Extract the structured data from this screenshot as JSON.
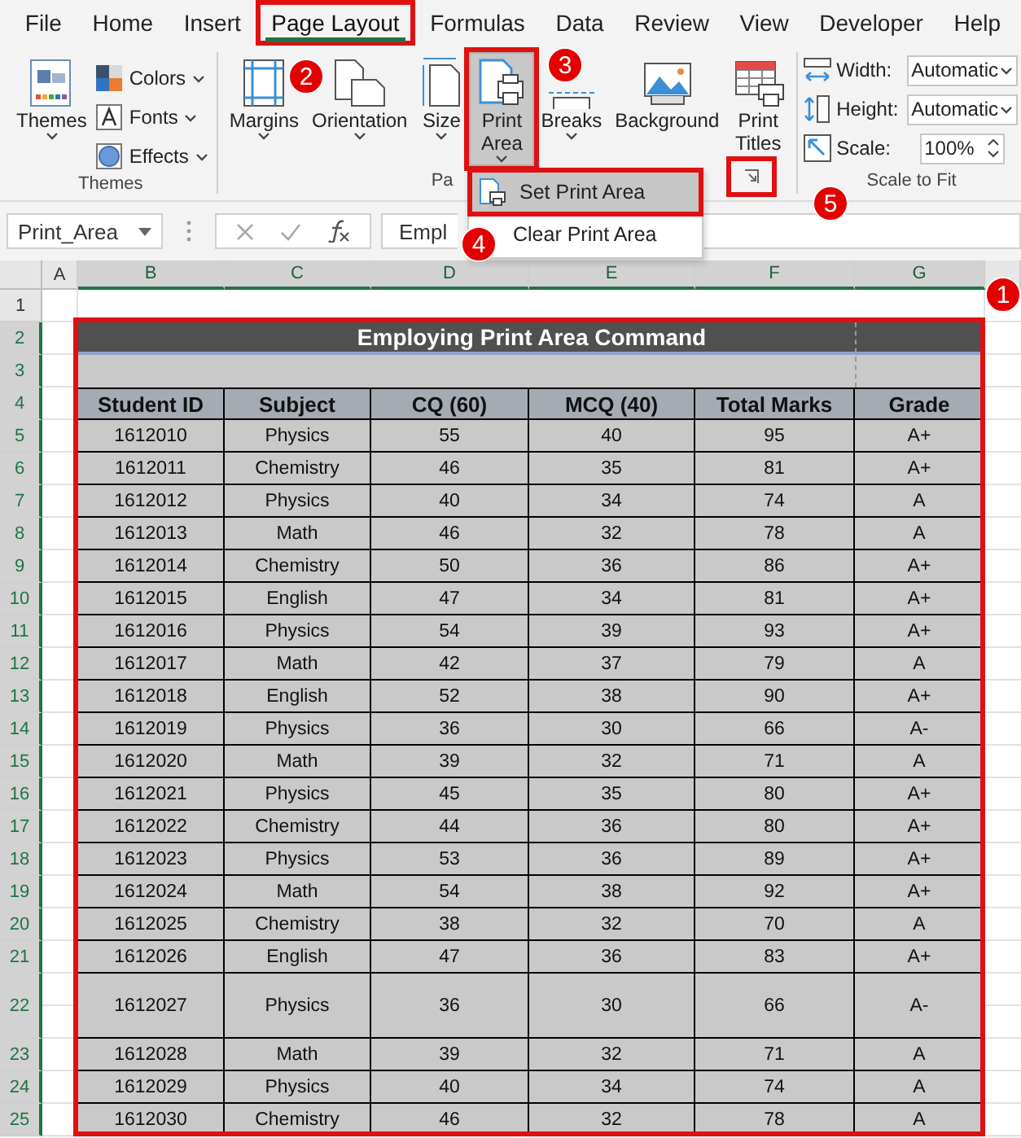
{
  "tabs": [
    {
      "label": "File",
      "selected": false,
      "highlighted": false
    },
    {
      "label": "Home",
      "selected": false,
      "highlighted": false
    },
    {
      "label": "Insert",
      "selected": false,
      "highlighted": false
    },
    {
      "label": "Page Layout",
      "selected": true,
      "highlighted": true
    },
    {
      "label": "Formulas",
      "selected": false,
      "highlighted": false
    },
    {
      "label": "Data",
      "selected": false,
      "highlighted": false
    },
    {
      "label": "Review",
      "selected": false,
      "highlighted": false
    },
    {
      "label": "View",
      "selected": false,
      "highlighted": false
    },
    {
      "label": "Developer",
      "selected": false,
      "highlighted": false
    },
    {
      "label": "Help",
      "selected": false,
      "highlighted": false
    }
  ],
  "ribbon": {
    "groups": [
      {
        "label": "Themes",
        "items": [
          {
            "kind": "large",
            "label": "Themes",
            "dropdown": true,
            "pressed": false,
            "highlighted": false
          },
          {
            "kind": "small",
            "label": "Colors",
            "dropdown": true
          },
          {
            "kind": "small",
            "label": "Fonts",
            "dropdown": true
          },
          {
            "kind": "small",
            "label": "Effects",
            "dropdown": true
          }
        ]
      },
      {
        "label": "Pa",
        "dialog_launcher": {
          "highlighted": true
        },
        "items": [
          {
            "kind": "large",
            "label": "Margins",
            "dropdown": true,
            "pressed": false,
            "highlighted": false
          },
          {
            "kind": "large",
            "label": "Orientation",
            "dropdown": true,
            "pressed": false,
            "highlighted": false
          },
          {
            "kind": "large",
            "label": "Size",
            "dropdown": true,
            "pressed": false,
            "highlighted": false
          },
          {
            "kind": "large",
            "label": "Print Area",
            "dropdown": true,
            "pressed": true,
            "highlighted": true
          },
          {
            "kind": "large",
            "label": "Breaks",
            "dropdown": true,
            "pressed": false,
            "highlighted": false
          },
          {
            "kind": "large",
            "label": "Background",
            "dropdown": false,
            "pressed": false,
            "highlighted": false
          },
          {
            "kind": "large",
            "label": "Print Titles",
            "dropdown": false,
            "pressed": false,
            "highlighted": false
          }
        ]
      },
      {
        "label": "Scale to Fit",
        "items": [
          {
            "kind": "select",
            "label": "Width:",
            "value": "Automatic"
          },
          {
            "kind": "select",
            "label": "Height:",
            "value": "Automatic"
          },
          {
            "kind": "spin",
            "label": "Scale:",
            "value": "100%"
          }
        ]
      }
    ]
  },
  "menu": {
    "items": [
      {
        "label": "Set Print Area",
        "selected": true,
        "highlighted": true
      },
      {
        "label": "Clear Print Area",
        "selected": false,
        "highlighted": false
      }
    ]
  },
  "formula_bar": {
    "name_box": "Print_Area",
    "formula": "Empl"
  },
  "sheet": {
    "columns": [
      {
        "label": "A",
        "selected": false
      },
      {
        "label": "B",
        "selected": true
      },
      {
        "label": "C",
        "selected": true
      },
      {
        "label": "D",
        "selected": true
      },
      {
        "label": "E",
        "selected": true
      },
      {
        "label": "F",
        "selected": true
      },
      {
        "label": "G",
        "selected": true
      }
    ],
    "row_numbers": [
      {
        "label": "1",
        "selected": false
      },
      {
        "label": "2",
        "selected": true
      },
      {
        "label": "3",
        "selected": true
      },
      {
        "label": "4",
        "selected": true
      },
      {
        "label": "5",
        "selected": true
      },
      {
        "label": "6",
        "selected": true
      },
      {
        "label": "7",
        "selected": true
      },
      {
        "label": "8",
        "selected": true
      },
      {
        "label": "9",
        "selected": true
      },
      {
        "label": "10",
        "selected": true
      },
      {
        "label": "11",
        "selected": true
      },
      {
        "label": "12",
        "selected": true
      },
      {
        "label": "13",
        "selected": true
      },
      {
        "label": "14",
        "selected": true
      },
      {
        "label": "15",
        "selected": true
      },
      {
        "label": "16",
        "selected": true
      },
      {
        "label": "17",
        "selected": true
      },
      {
        "label": "18",
        "selected": true
      },
      {
        "label": "19",
        "selected": true
      },
      {
        "label": "20",
        "selected": true
      },
      {
        "label": "21",
        "selected": true
      },
      {
        "label": "22",
        "selected": true
      },
      {
        "label": "23",
        "selected": true
      },
      {
        "label": "24",
        "selected": true
      },
      {
        "label": "25",
        "selected": true
      }
    ],
    "table": {
      "title": "Employing Print Area Command",
      "highlighted": true,
      "columns": [
        "Student ID",
        "Subject",
        "CQ  (60)",
        "MCQ  (40)",
        "Total Marks",
        "Grade"
      ],
      "rows": [
        [
          "1612010",
          "Physics",
          "55",
          "40",
          "95",
          "A+"
        ],
        [
          "1612011",
          "Chemistry",
          "46",
          "35",
          "81",
          "A+"
        ],
        [
          "1612012",
          "Physics",
          "40",
          "34",
          "74",
          "A"
        ],
        [
          "1612013",
          "Math",
          "46",
          "32",
          "78",
          "A"
        ],
        [
          "1612014",
          "Chemistry",
          "50",
          "36",
          "86",
          "A+"
        ],
        [
          "1612015",
          "English",
          "47",
          "34",
          "81",
          "A+"
        ],
        [
          "1612016",
          "Physics",
          "54",
          "39",
          "93",
          "A+"
        ],
        [
          "1612017",
          "Math",
          "42",
          "37",
          "79",
          "A"
        ],
        [
          "1612018",
          "English",
          "52",
          "38",
          "90",
          "A+"
        ],
        [
          "1612019",
          "Physics",
          "36",
          "30",
          "66",
          "A-"
        ],
        [
          "1612020",
          "Math",
          "39",
          "32",
          "71",
          "A"
        ],
        [
          "1612021",
          "Physics",
          "45",
          "35",
          "80",
          "A+"
        ],
        [
          "1612022",
          "Chemistry",
          "44",
          "36",
          "80",
          "A+"
        ],
        [
          "1612023",
          "Physics",
          "53",
          "36",
          "89",
          "A+"
        ],
        [
          "1612024",
          "Math",
          "54",
          "38",
          "92",
          "A+"
        ],
        [
          "1612025",
          "Chemistry",
          "38",
          "32",
          "70",
          "A"
        ],
        [
          "1612026",
          "English",
          "47",
          "36",
          "83",
          "A+"
        ],
        [
          "1612027",
          "Physics",
          "36",
          "30",
          "66",
          "A-"
        ],
        [
          "1612028",
          "Math",
          "39",
          "32",
          "71",
          "A"
        ],
        [
          "1612029",
          "Physics",
          "40",
          "34",
          "74",
          "A"
        ],
        [
          "1612030",
          "Chemistry",
          "46",
          "32",
          "78",
          "A"
        ]
      ]
    }
  },
  "callouts": [
    "1",
    "2",
    "3",
    "4",
    "5"
  ]
}
